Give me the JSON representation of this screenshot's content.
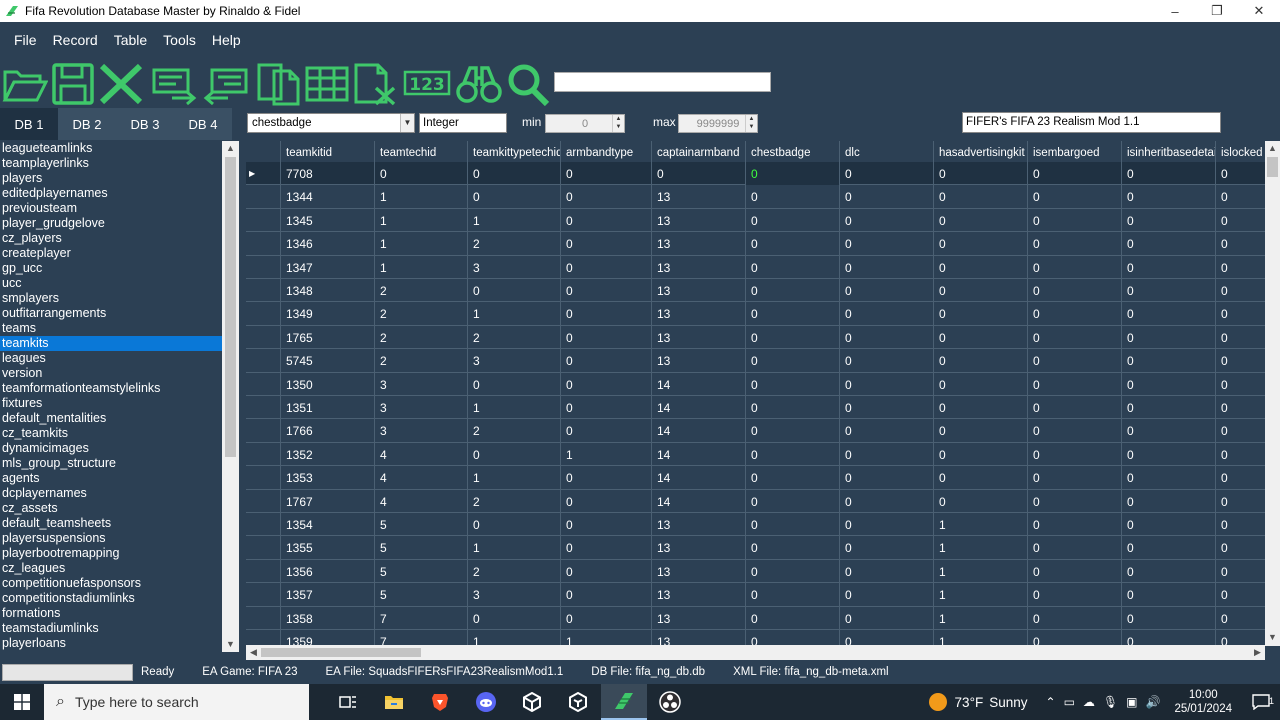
{
  "window": {
    "title": "Fifa Revolution Database Master by Rinaldo & Fidel",
    "minimize": "–",
    "restore": "❐",
    "close": "✕"
  },
  "menu": [
    "File",
    "Record",
    "Table",
    "Tools",
    "Help"
  ],
  "toolbar": {
    "icons": [
      "open-folder-icon",
      "save-icon",
      "close-icon",
      "export-icon",
      "import-icon",
      "copy-icon",
      "table-icon",
      "csv-icon",
      "numbers-icon",
      "binoculars-icon",
      "search-icon"
    ],
    "numbers_text": "123",
    "search_value": ""
  },
  "db_tabs": [
    {
      "label": "DB 1",
      "active": true
    },
    {
      "label": "DB 2",
      "active": false
    },
    {
      "label": "DB 3",
      "active": false
    },
    {
      "label": "DB 4",
      "active": false
    }
  ],
  "table_list": {
    "selected": "teamkits",
    "items": [
      "leagueteamlinks",
      "teamplayerlinks",
      "players",
      "editedplayernames",
      "previousteam",
      "player_grudgelove",
      "cz_players",
      "createplayer",
      "gp_ucc",
      "ucc",
      "smplayers",
      "outfitarrangements",
      "teams",
      "teamkits",
      "leagues",
      "version",
      "teamformationteamstylelinks",
      "fixtures",
      "default_mentalities",
      "cz_teamkits",
      "dynamicimages",
      "mls_group_structure",
      "agents",
      "dcplayernames",
      "cz_assets",
      "default_teamsheets",
      "playersuspensions",
      "playerbootremapping",
      "cz_leagues",
      "competitionuefasponsors",
      "competitionstadiumlinks",
      "formations",
      "teamstadiumlinks",
      "playerloans"
    ]
  },
  "field_bar": {
    "field": "chestbadge",
    "type": "Integer",
    "min_label": "min",
    "min_value": "0",
    "max_label": "max",
    "max_value": "9999999",
    "mod_name": "FIFER's FIFA 23 Realism Mod 1.1"
  },
  "grid": {
    "columns": [
      "teamkitid",
      "teamtechid",
      "teamkittypetechid",
      "armbandtype",
      "captainarmband",
      "chestbadge",
      "dlc",
      "hasadvertisingkit",
      "isembargoed",
      "isinheritbasedetail",
      "islocked"
    ],
    "rows": [
      [
        "7708",
        "0",
        "0",
        "0",
        "0",
        "0",
        "0",
        "0",
        "0",
        "0",
        "0"
      ],
      [
        "1344",
        "1",
        "0",
        "0",
        "13",
        "0",
        "0",
        "0",
        "0",
        "0",
        "0"
      ],
      [
        "1345",
        "1",
        "1",
        "0",
        "13",
        "0",
        "0",
        "0",
        "0",
        "0",
        "0"
      ],
      [
        "1346",
        "1",
        "2",
        "0",
        "13",
        "0",
        "0",
        "0",
        "0",
        "0",
        "0"
      ],
      [
        "1347",
        "1",
        "3",
        "0",
        "13",
        "0",
        "0",
        "0",
        "0",
        "0",
        "0"
      ],
      [
        "1348",
        "2",
        "0",
        "0",
        "13",
        "0",
        "0",
        "0",
        "0",
        "0",
        "0"
      ],
      [
        "1349",
        "2",
        "1",
        "0",
        "13",
        "0",
        "0",
        "0",
        "0",
        "0",
        "0"
      ],
      [
        "1765",
        "2",
        "2",
        "0",
        "13",
        "0",
        "0",
        "0",
        "0",
        "0",
        "0"
      ],
      [
        "5745",
        "2",
        "3",
        "0",
        "13",
        "0",
        "0",
        "0",
        "0",
        "0",
        "0"
      ],
      [
        "1350",
        "3",
        "0",
        "0",
        "14",
        "0",
        "0",
        "0",
        "0",
        "0",
        "0"
      ],
      [
        "1351",
        "3",
        "1",
        "0",
        "14",
        "0",
        "0",
        "0",
        "0",
        "0",
        "0"
      ],
      [
        "1766",
        "3",
        "2",
        "0",
        "14",
        "0",
        "0",
        "0",
        "0",
        "0",
        "0"
      ],
      [
        "1352",
        "4",
        "0",
        "1",
        "14",
        "0",
        "0",
        "0",
        "0",
        "0",
        "0"
      ],
      [
        "1353",
        "4",
        "1",
        "0",
        "14",
        "0",
        "0",
        "0",
        "0",
        "0",
        "0"
      ],
      [
        "1767",
        "4",
        "2",
        "0",
        "14",
        "0",
        "0",
        "0",
        "0",
        "0",
        "0"
      ],
      [
        "1354",
        "5",
        "0",
        "0",
        "13",
        "0",
        "0",
        "1",
        "0",
        "0",
        "0"
      ],
      [
        "1355",
        "5",
        "1",
        "0",
        "13",
        "0",
        "0",
        "1",
        "0",
        "0",
        "0"
      ],
      [
        "1356",
        "5",
        "2",
        "0",
        "13",
        "0",
        "0",
        "1",
        "0",
        "0",
        "0"
      ],
      [
        "1357",
        "5",
        "3",
        "0",
        "13",
        "0",
        "0",
        "1",
        "0",
        "0",
        "0"
      ],
      [
        "1358",
        "7",
        "0",
        "0",
        "13",
        "0",
        "0",
        "1",
        "0",
        "0",
        "0"
      ],
      [
        "1359",
        "7",
        "1",
        "1",
        "13",
        "0",
        "0",
        "1",
        "0",
        "0",
        "0"
      ]
    ],
    "current_row": 0,
    "current_col": 5
  },
  "statusbar": {
    "ready": "Ready",
    "game": "EA Game: FIFA 23",
    "ea_file": "EA File: SquadsFIFERsFIFA23RealismMod1.1",
    "db_file": "DB File: fifa_ng_db.db",
    "xml_file": "XML File: fifa_ng_db-meta.xml"
  },
  "taskbar": {
    "search_placeholder": "Type here to search",
    "apps": [
      "task-view-icon",
      "file-explorer-icon",
      "brave-icon",
      "discord-icon",
      "app-cube-icon",
      "app-cube2-icon",
      "db-master-icon",
      "obs-icon"
    ],
    "weather_temp": "73°F",
    "weather_desc": "Sunny",
    "time": "10:00",
    "date": "25/01/2024",
    "notif_count": "1"
  },
  "colors": {
    "background": "#2c4054",
    "selected": "#0a78d7",
    "toolbar_icon": "#3fc86a",
    "current_cell_text": "#3fff3f"
  }
}
